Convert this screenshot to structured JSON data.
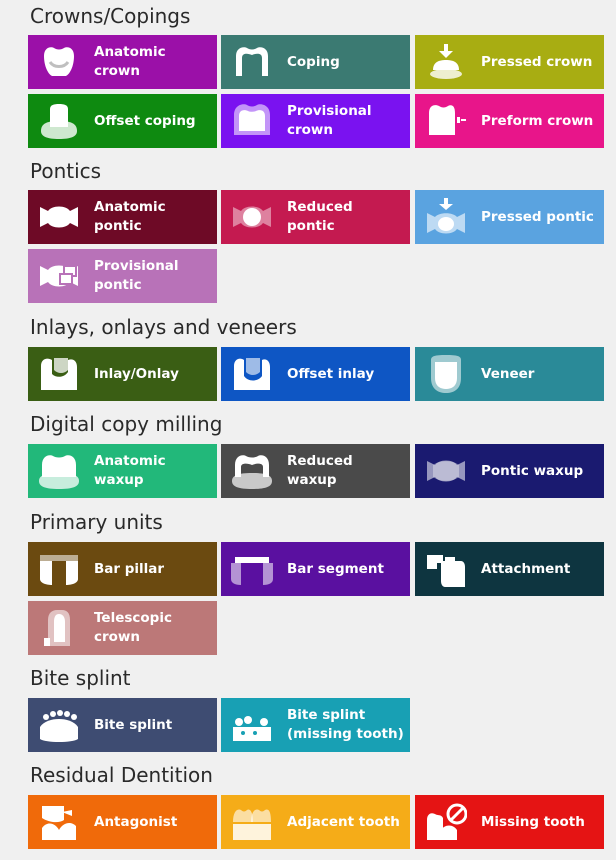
{
  "sections": [
    {
      "title": "Crowns/Copings",
      "tiles": [
        {
          "label": "Anatomic crown",
          "color": "#9b10a8",
          "icon": "anatomic-crown-icon"
        },
        {
          "label": "Coping",
          "color": "#3b7a72",
          "icon": "coping-icon"
        },
        {
          "label": "Pressed crown",
          "color": "#a8ad12",
          "icon": "pressed-crown-icon"
        },
        {
          "label": "Offset coping",
          "color": "#0e8a10",
          "icon": "offset-coping-icon"
        },
        {
          "label": "Provisional crown",
          "color": "#7a12f0",
          "icon": "provisional-crown-icon"
        },
        {
          "label": "Preform crown",
          "color": "#e8158a",
          "icon": "preform-crown-icon"
        }
      ]
    },
    {
      "title": "Pontics",
      "tiles": [
        {
          "label": "Anatomic pontic",
          "color": "#6e0a26",
          "icon": "anatomic-pontic-icon"
        },
        {
          "label": "Reduced pontic",
          "color": "#c41a50",
          "icon": "reduced-pontic-icon"
        },
        {
          "label": "Pressed pontic",
          "color": "#5aa3e0",
          "icon": "pressed-pontic-icon"
        },
        {
          "label": "Provisional pontic",
          "color": "#b872b8",
          "icon": "provisional-pontic-icon"
        }
      ]
    },
    {
      "title": "Inlays, onlays and veneers",
      "tiles": [
        {
          "label": "Inlay/Onlay",
          "color": "#3a5e14",
          "icon": "inlay-onlay-icon"
        },
        {
          "label": "Offset inlay",
          "color": "#0e56c4",
          "icon": "offset-inlay-icon"
        },
        {
          "label": "Veneer",
          "color": "#2a8a98",
          "icon": "veneer-icon"
        }
      ]
    },
    {
      "title": "Digital copy milling",
      "tiles": [
        {
          "label": "Anatomic waxup",
          "color": "#22b87a",
          "icon": "anatomic-waxup-icon"
        },
        {
          "label": "Reduced waxup",
          "color": "#4a4a4a",
          "icon": "reduced-waxup-icon"
        },
        {
          "label": "Pontic waxup",
          "color": "#1a1a70",
          "icon": "pontic-waxup-icon"
        }
      ]
    },
    {
      "title": "Primary units",
      "tiles": [
        {
          "label": "Bar pillar",
          "color": "#6b4a10",
          "icon": "bar-pillar-icon"
        },
        {
          "label": "Bar segment",
          "color": "#5a10a0",
          "icon": "bar-segment-icon"
        },
        {
          "label": "Attachment",
          "color": "#0e3540",
          "icon": "attachment-icon"
        },
        {
          "label": "Telescopic crown",
          "color": "#bc7878",
          "icon": "telescopic-crown-icon"
        }
      ]
    },
    {
      "title": "Bite splint",
      "tiles": [
        {
          "label": "Bite splint",
          "color": "#3e4c72",
          "icon": "bite-splint-icon"
        },
        {
          "label": "Bite splint (missing tooth)",
          "color": "#18a0b4",
          "icon": "bite-splint-missing-tooth-icon"
        }
      ]
    },
    {
      "title": "Residual Dentition",
      "tiles": [
        {
          "label": "Antagonist",
          "color": "#f06a0a",
          "icon": "antagonist-icon"
        },
        {
          "label": "Adjacent tooth",
          "color": "#f5ac18",
          "icon": "adjacent-tooth-icon"
        },
        {
          "label": "Missing tooth",
          "color": "#e51414",
          "icon": "missing-tooth-icon"
        }
      ]
    }
  ]
}
